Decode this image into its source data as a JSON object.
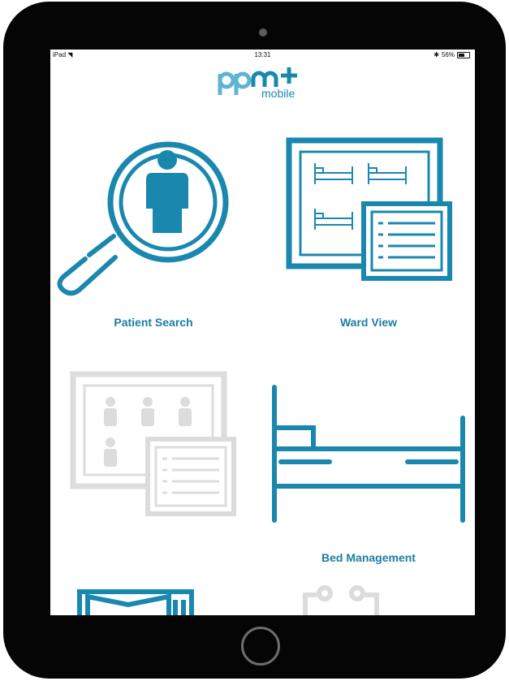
{
  "status_bar": {
    "device": "iPad",
    "time": "13:31",
    "bluetooth_icon": "bluetooth-icon",
    "battery_percent": "56%",
    "battery_level": 0.56
  },
  "logo": {
    "text_main": "ppm+",
    "text_sub": "mobile"
  },
  "colors": {
    "accent": "#1a88ae",
    "label": "#1b7ea3",
    "disabled": "#dcdcdc",
    "frame": "#050505"
  },
  "tiles": [
    {
      "label": "Patient Search",
      "icon": "magnifier-person-icon",
      "enabled": true
    },
    {
      "label": "Ward View",
      "icon": "ward-beds-icon",
      "enabled": true
    },
    {
      "label": "",
      "icon": "patient-list-icon",
      "enabled": false
    },
    {
      "label": "Bed Management",
      "icon": "bed-icon",
      "enabled": true
    },
    {
      "label": "",
      "icon": "folder-icon",
      "enabled": true
    },
    {
      "label": "",
      "icon": "clipboard-icon",
      "enabled": false
    }
  ]
}
